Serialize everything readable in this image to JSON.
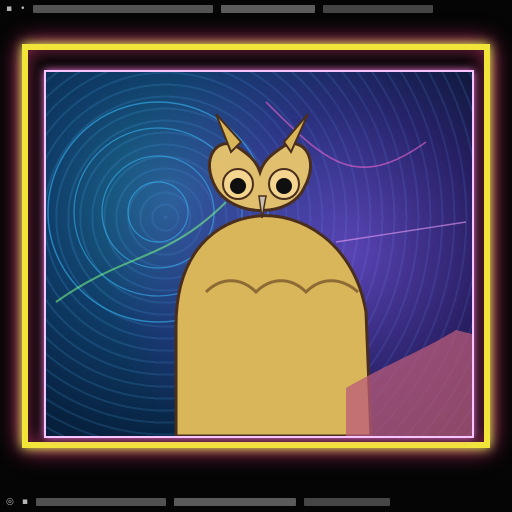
{
  "colors": {
    "frame": "#f2e53a",
    "frame_glow": "#ff3c8f",
    "inner_bg": "#0f3c68",
    "owl": "#d9b65a",
    "owl_shadow": "#7a4e2a"
  },
  "icons": {
    "top_left": "small-square-icon",
    "bottom_left": "circle-icon"
  }
}
